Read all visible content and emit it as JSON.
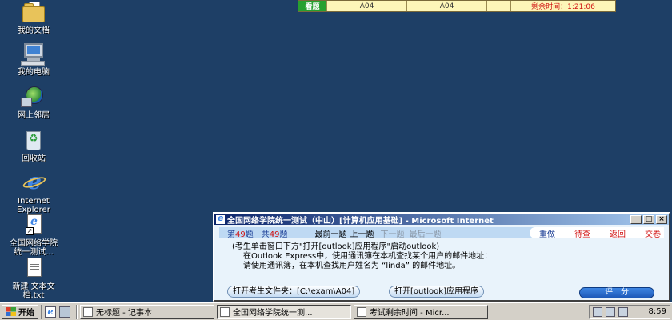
{
  "desktop": {
    "icons": [
      {
        "label": "我的文档",
        "icon": "folder-icon"
      },
      {
        "label": "我的电脑",
        "icon": "computer-icon"
      },
      {
        "label": "网上邻居",
        "icon": "network-icon"
      },
      {
        "label": "回收站",
        "icon": "recycle-bin-icon"
      },
      {
        "label": "Internet\nExplorer",
        "icon": "ie-icon"
      },
      {
        "label": "全国网络学院\n统一测试...",
        "icon": "shortcut-ie-icon"
      },
      {
        "label": "新建 文本文\n档.txt",
        "icon": "text-file-icon"
      }
    ]
  },
  "exam_status": {
    "status": "看题",
    "code_1": "A04",
    "code_2": "A04",
    "remaining_time": "剩余时间：1:21:06"
  },
  "exam_window": {
    "title": "全国网络学院统一测试（中山）[计算机应用基础] - Microsoft Internet",
    "nav": {
      "question_prefix": "第",
      "question_number": "49",
      "question_suffix": "题",
      "total_prefix": "共",
      "total_number": "49",
      "total_suffix": "题",
      "first": "最前一题",
      "prev": "上一题",
      "next": "下一题",
      "last": "最后一题",
      "redo": "重做",
      "pending": "待查",
      "back": "返回",
      "submit": "交卷"
    },
    "content": {
      "line1": "(考生单击窗口下方\"打开[outlook]应用程序\"启动outlook)",
      "line2": "在Outlook Express中，使用通讯簿在本机查找某个用户的邮件地址：",
      "line3": "请使用通讯簿，在本机查找用户姓名为 “linda” 的邮件地址。"
    },
    "buttons": {
      "open_folder": "打开考生文件夹：[C:\\exam\\A04]",
      "open_outlook": "打开[outlook]应用程序",
      "score": "评　分"
    }
  },
  "taskbar": {
    "start_label": "开始",
    "tasks": [
      {
        "label": "无标题 - 记事本"
      },
      {
        "label": "全国网络学院统一测..."
      },
      {
        "label": "考试剩余时间 - Micr..."
      }
    ],
    "clock": "8:59"
  },
  "colors": {
    "desktop": "#1e3f66",
    "status_green": "#27a030",
    "timer_red": "#d01010",
    "title_blue": "#0a246a"
  }
}
